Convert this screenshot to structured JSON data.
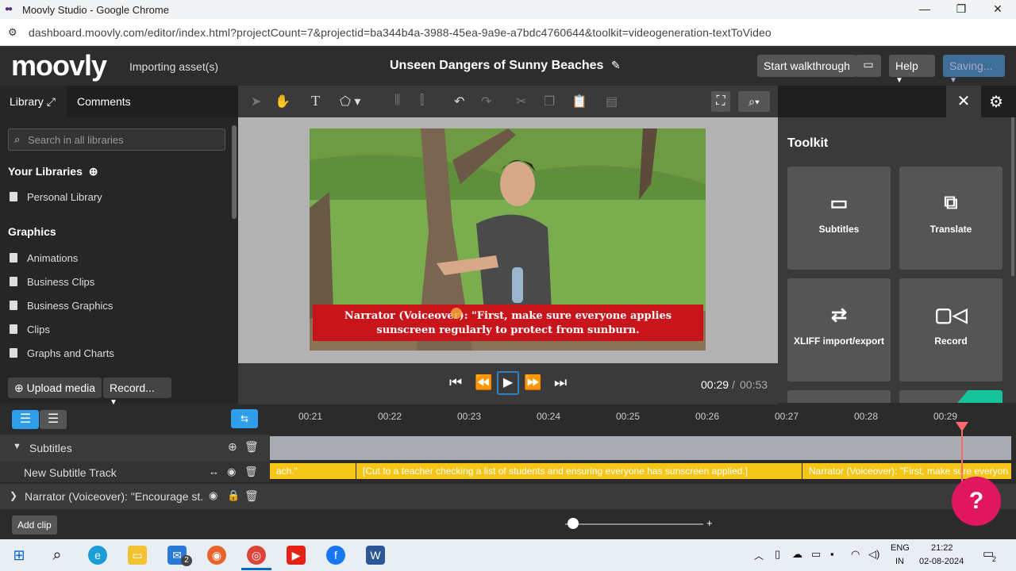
{
  "window": {
    "title": "Moovly Studio - Google Chrome"
  },
  "browser": {
    "url": "dashboard.moovly.com/editor/index.html?projectCount=7&projectid=ba344b4a-3988-45ea-9a9e-a7bdc4760644&toolkit=videogeneration-textToVideo"
  },
  "header": {
    "brand": "moovly",
    "status": "Importing asset(s)",
    "project_title": "Unseen Dangers of Sunny Beaches",
    "walkthrough_label": "Start walkthrough",
    "help_label": "Help",
    "saving_label": "Saving..."
  },
  "library": {
    "tab_library": "Library",
    "tab_comments": "Comments",
    "search_placeholder": "Search in all libraries",
    "your_libraries": "Your Libraries",
    "personal": "Personal Library",
    "graphics_heading": "Graphics",
    "items": [
      "Animations",
      "Business Clips",
      "Business Graphics",
      "Clips",
      "Graphs and Charts"
    ],
    "upload_label": "Upload media",
    "record_label": "Record..."
  },
  "video": {
    "caption_line1": "Narrator (Voiceover): \"First, make sure everyone applies",
    "caption_line2": "sunscreen regularly to protect from sunburn."
  },
  "playback": {
    "current": "00:29",
    "separator": "/",
    "total": "00:53"
  },
  "toolkit": {
    "title": "Toolkit",
    "cards": [
      {
        "label": "Subtitles",
        "icon": "subtitles-icon"
      },
      {
        "label": "Translate",
        "icon": "translate-icon"
      },
      {
        "label": "XLIFF import/export",
        "icon": "xliff-icon"
      },
      {
        "label": "Record",
        "icon": "video-camera-icon"
      }
    ]
  },
  "timeline": {
    "ticks": [
      "00:21",
      "00:22",
      "00:23",
      "00:24",
      "00:25",
      "00:26",
      "00:27",
      "00:28",
      "00:29"
    ],
    "subtitles_label": "Subtitles",
    "track_label": "New Subtitle Track",
    "narrator_label": "Narrator (Voiceover): \"Encourage st...",
    "clips": [
      "ach.\"",
      "[Cut to a teacher checking a list of students and ensuring everyone has sunscreen applied.]",
      "Narrator (Voiceover): \"First, make sure everyon"
    ],
    "add_clip_label": "Add clip",
    "help_fab": "?"
  },
  "taskbar": {
    "lang_top": "ENG",
    "lang_bottom": "IN",
    "time": "21:22",
    "date": "02-08-2024",
    "notif_count": "2",
    "mail_badge": "2"
  },
  "colors": {
    "accent_blue": "#2f80c2",
    "caption_red": "#c8151b",
    "clip_yellow": "#f5c518",
    "fab_pink": "#e0165f",
    "playhead": "#ff6b6b"
  }
}
